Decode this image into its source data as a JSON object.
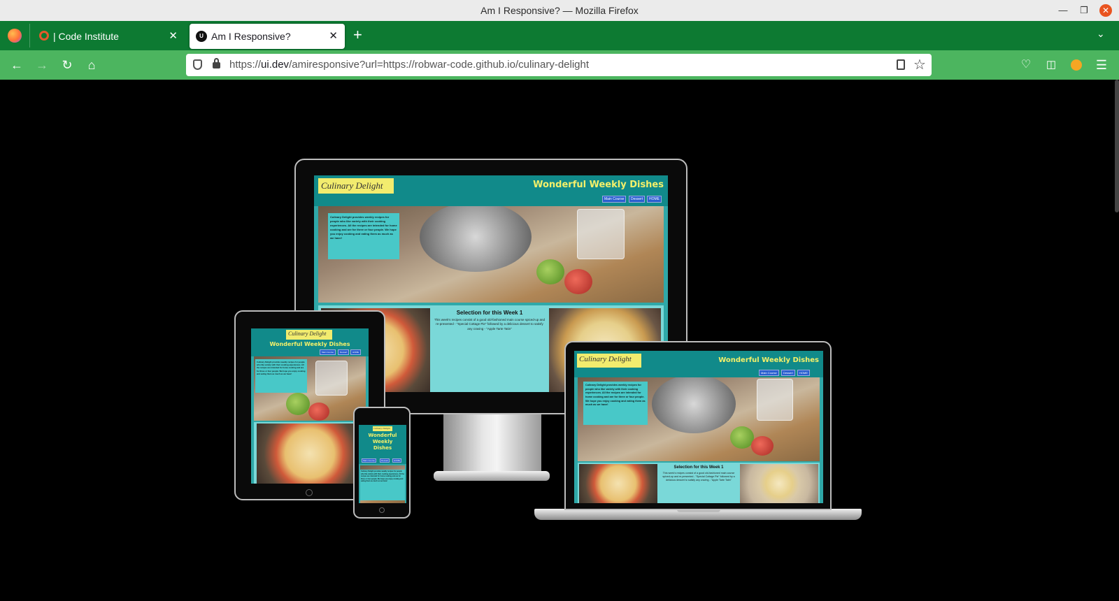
{
  "window": {
    "title": "Am I Responsive? — Mozilla Firefox"
  },
  "tabs": [
    {
      "label": "| Code Institute",
      "active": false
    },
    {
      "label": "Am I Responsive?",
      "active": true
    }
  ],
  "address": {
    "domain": "ui.dev",
    "prefix": "https://",
    "path": "/amiresponsive?url=https://robwar-code.github.io/culinary-delight"
  },
  "site": {
    "logo": "Culinary Delight",
    "title": "Wonderful Weekly Dishes",
    "mobile_title": "Wonderful Weekly Dishes",
    "nav": [
      "Main Course",
      "Dessert",
      "HOME"
    ],
    "intro": "Culinary Delight provides weekly recipes for people who like variety with their cooking experiences. All the recipes are intended for home cooking and are for three or four people. We hope you enjoy cooking and eating them as much as we have!",
    "selection_title": "Selection for this Week 1",
    "selection_text": "This week's recipes consist of a good old-fashioned main course spiced-up and re-presented - \"Special Cottage Pie\" followed by a delicious dessert to satisfy any craving - \"Apple Tarte Tatin\""
  },
  "colors": {
    "tabbar": "#0d7a32",
    "navbar": "#4cb55f",
    "site_header": "#118a8a",
    "site_title": "#f4f06a",
    "logo_bg": "#f2ec6e",
    "intro_bg": "#48c8c8",
    "lower_bg": "#7ad8d8"
  }
}
